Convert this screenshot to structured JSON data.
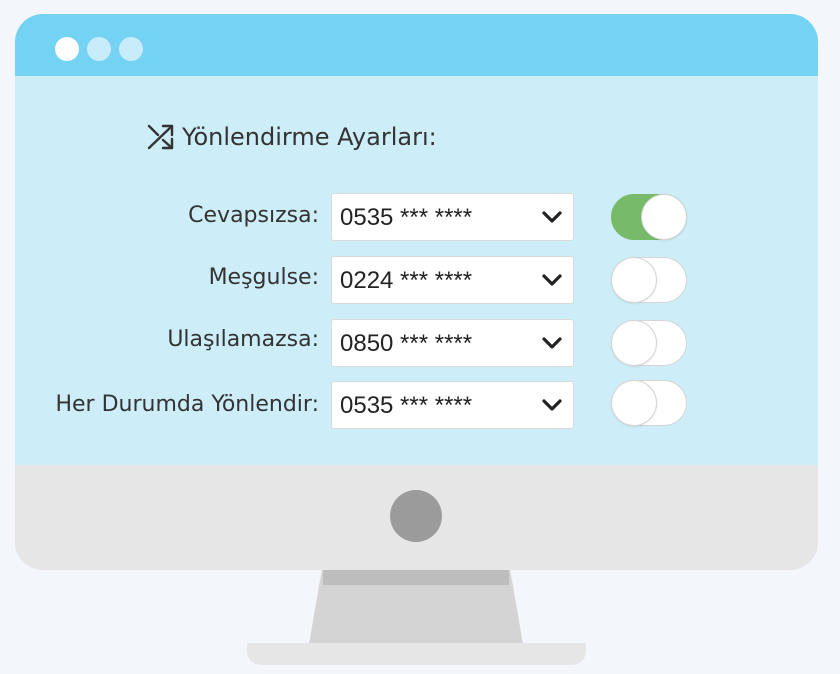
{
  "window": {
    "dots": [
      "close",
      "minimize",
      "maximize"
    ]
  },
  "panel": {
    "icon": "shuffle-icon",
    "title": "Yönlendirme Ayarları:"
  },
  "rows": [
    {
      "label": "Cevapsızsa:",
      "number": "0535 *** ****",
      "enabled": true
    },
    {
      "label": "Meşgulse:",
      "number": "0224 *** ****",
      "enabled": false
    },
    {
      "label": "Ulaşılamazsa:",
      "number": "0850 *** ****",
      "enabled": false
    },
    {
      "label": "Her Durumda Yönlendir:",
      "number": "0535 *** ****",
      "enabled": false
    }
  ],
  "colors": {
    "titlebar": "#74d3f3",
    "screen": "#cdeef9",
    "toggle_on": "#77bb6a",
    "bezel": "#e6e6e6"
  }
}
